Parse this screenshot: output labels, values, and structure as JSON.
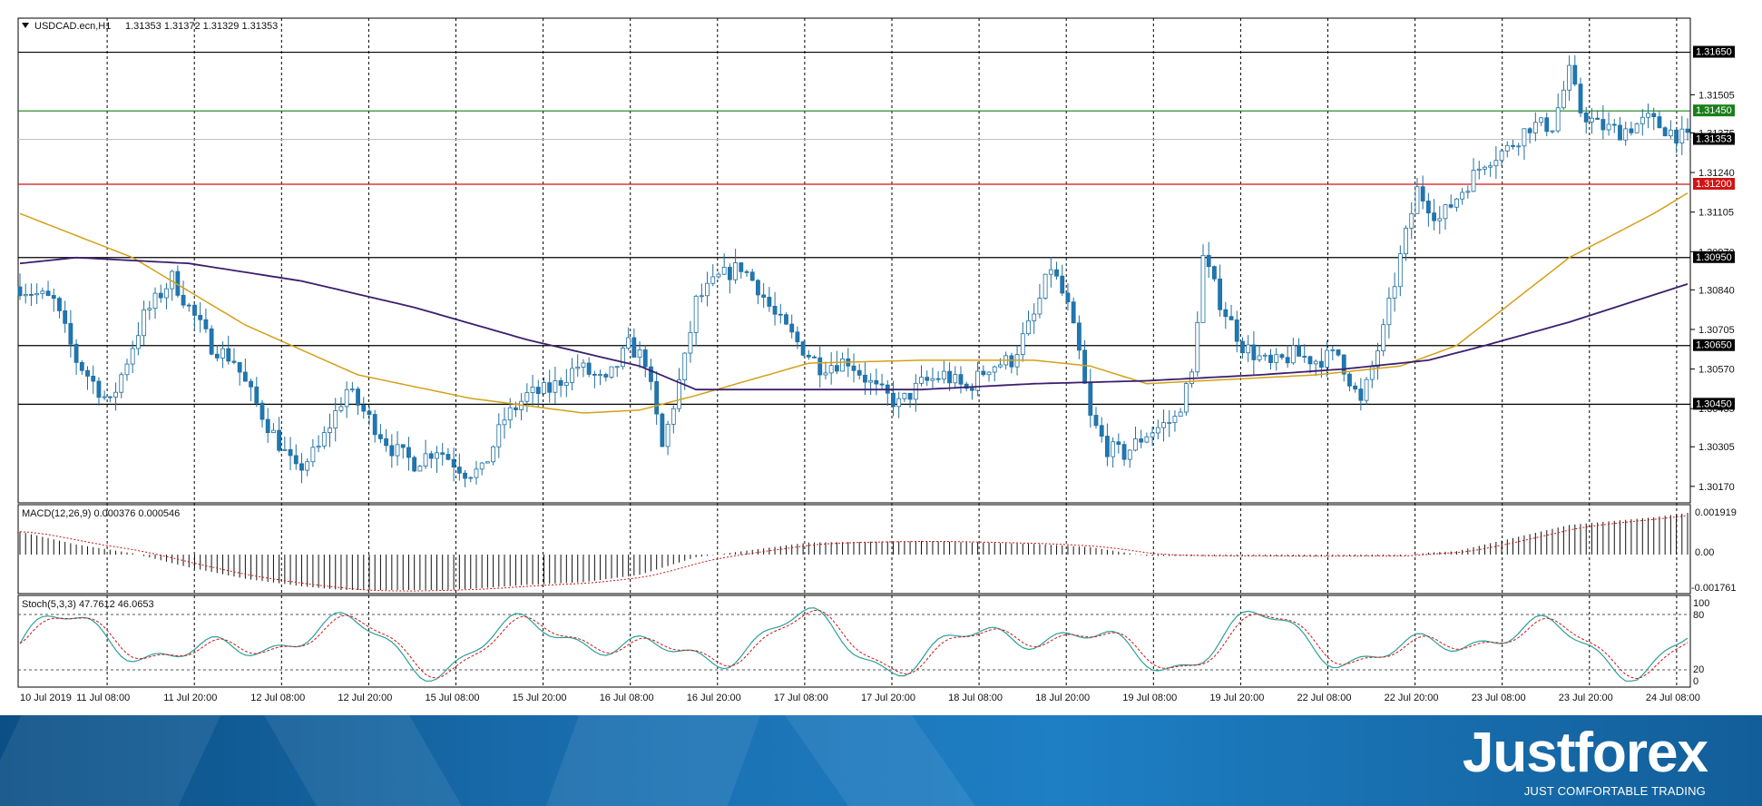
{
  "header": {
    "symbol": "USDCAD.ecn,H1",
    "ohlc": "1.31353 1.31372 1.31329 1.31353"
  },
  "colors": {
    "candle_up": "#ffffff",
    "candle_down": "#1f77b4",
    "candle_outline": "#1f6e9e",
    "ma_fast": "#d4a017",
    "ma_slow": "#3c1f6e",
    "level_black": "#000000",
    "level_green": "#1a7f1a",
    "level_red": "#d11414",
    "bid_line": "#bfbfbf",
    "macd_signal": "#d11414",
    "stoch_main": "#2aa198",
    "stoch_signal": "#d11414",
    "footer_blue": "#1a6fb0"
  },
  "price_axis": {
    "labels": [
      "1.31505",
      "1.31375",
      "1.31240",
      "1.31105",
      "1.30970",
      "1.30840",
      "1.30705",
      "1.30570",
      "1.30435",
      "1.30305",
      "1.30170"
    ]
  },
  "levels": [
    {
      "label": "1.31650",
      "value": 1.3165,
      "color": "black"
    },
    {
      "label": "1.31450",
      "value": 1.3145,
      "color": "green"
    },
    {
      "label": "1.31200",
      "value": 1.312,
      "color": "red"
    },
    {
      "label": "1.30950",
      "value": 1.3095,
      "color": "black"
    },
    {
      "label": "1.30650",
      "value": 1.3065,
      "color": "black"
    },
    {
      "label": "1.30450",
      "value": 1.3045,
      "color": "black"
    }
  ],
  "bid": {
    "label": "1.31353",
    "value": 1.31353
  },
  "time_axis": {
    "labels": [
      "10 Jul 2019",
      "11 Jul 08:00",
      "11 Jul 20:00",
      "12 Jul 08:00",
      "12 Jul 20:00",
      "15 Jul 08:00",
      "15 Jul 20:00",
      "16 Jul 08:00",
      "16 Jul 20:00",
      "17 Jul 08:00",
      "17 Jul 20:00",
      "18 Jul 08:00",
      "18 Jul 20:00",
      "19 Jul 08:00",
      "19 Jul 20:00",
      "22 Jul 08:00",
      "22 Jul 20:00",
      "23 Jul 08:00",
      "23 Jul 20:00",
      "24 Jul 08:00"
    ]
  },
  "macd": {
    "title": "MACD(12,26,9) 0.000376 0.000546",
    "axis_labels": [
      "0.001919",
      "0.00",
      "-0.001761"
    ]
  },
  "stoch": {
    "title": "Stoch(5,3,3) 47.7612 46.0653",
    "axis_labels": [
      "100",
      "80",
      "20",
      "0"
    ]
  },
  "footer": {
    "brand": "Justforex",
    "tagline": "JUST COMFORTABLE TRADING"
  },
  "chart_data": {
    "type": "candlestick",
    "symbol": "USDCAD",
    "timeframe": "H1",
    "ylim": [
      1.3012,
      1.3176
    ],
    "close_path": [
      [
        0,
        1.3085
      ],
      [
        6,
        1.308
      ],
      [
        10,
        1.306
      ],
      [
        16,
        1.3045
      ],
      [
        22,
        1.3075
      ],
      [
        27,
        1.3088
      ],
      [
        30,
        1.3078
      ],
      [
        34,
        1.3065
      ],
      [
        38,
        1.306
      ],
      [
        40,
        1.3052
      ],
      [
        44,
        1.3038
      ],
      [
        49,
        1.3022
      ],
      [
        53,
        1.303
      ],
      [
        58,
        1.305
      ],
      [
        62,
        1.304
      ],
      [
        66,
        1.303
      ],
      [
        70,
        1.3025
      ],
      [
        74,
        1.303
      ],
      [
        79,
        1.3022
      ],
      [
        82,
        1.3022
      ],
      [
        86,
        1.304
      ],
      [
        90,
        1.3048
      ],
      [
        94,
        1.305
      ],
      [
        99,
        1.3058
      ],
      [
        104,
        1.3052
      ],
      [
        108,
        1.3065
      ],
      [
        111,
        1.306
      ],
      [
        114,
        1.303
      ],
      [
        118,
        1.306
      ],
      [
        120,
        1.308
      ],
      [
        124,
        1.3088
      ],
      [
        128,
        1.3092
      ],
      [
        131,
        1.3085
      ],
      [
        134,
        1.3075
      ],
      [
        138,
        1.3066
      ],
      [
        142,
        1.3058
      ],
      [
        147,
        1.306
      ],
      [
        152,
        1.305
      ],
      [
        156,
        1.3045
      ],
      [
        160,
        1.3052
      ],
      [
        164,
        1.3055
      ],
      [
        168,
        1.305
      ],
      [
        172,
        1.3058
      ],
      [
        176,
        1.306
      ],
      [
        180,
        1.3075
      ],
      [
        183,
        1.3092
      ],
      [
        186,
        1.3078
      ],
      [
        188,
        1.3062
      ],
      [
        190,
        1.304
      ],
      [
        193,
        1.303
      ],
      [
        196,
        1.3028
      ],
      [
        200,
        1.3035
      ],
      [
        205,
        1.304
      ],
      [
        208,
        1.3055
      ],
      [
        210,
        1.3095
      ],
      [
        213,
        1.308
      ],
      [
        217,
        1.3065
      ],
      [
        222,
        1.3058
      ],
      [
        226,
        1.3062
      ],
      [
        230,
        1.306
      ],
      [
        234,
        1.3062
      ],
      [
        238,
        1.3045
      ],
      [
        242,
        1.307
      ],
      [
        245,
        1.3095
      ],
      [
        248,
        1.3118
      ],
      [
        252,
        1.3108
      ],
      [
        256,
        1.3118
      ],
      [
        260,
        1.3128
      ],
      [
        264,
        1.3132
      ],
      [
        268,
        1.314
      ],
      [
        272,
        1.314
      ],
      [
        275,
        1.3158
      ],
      [
        277,
        1.3145
      ],
      [
        280,
        1.314
      ],
      [
        284,
        1.3138
      ],
      [
        289,
        1.3142
      ],
      [
        293,
        1.3138
      ],
      [
        296,
        1.3135
      ]
    ],
    "ma_fast_path": [
      [
        0,
        1.311
      ],
      [
        20,
        1.3095
      ],
      [
        40,
        1.3072
      ],
      [
        60,
        1.3055
      ],
      [
        80,
        1.3047
      ],
      [
        100,
        1.3042
      ],
      [
        110,
        1.3043
      ],
      [
        120,
        1.3048
      ],
      [
        140,
        1.3059
      ],
      [
        160,
        1.306
      ],
      [
        180,
        1.306
      ],
      [
        190,
        1.3058
      ],
      [
        200,
        1.3052
      ],
      [
        210,
        1.3053
      ],
      [
        230,
        1.3055
      ],
      [
        245,
        1.3058
      ],
      [
        255,
        1.3065
      ],
      [
        265,
        1.308
      ],
      [
        275,
        1.3095
      ],
      [
        290,
        1.311
      ],
      [
        296,
        1.3117
      ]
    ],
    "ma_slow_path": [
      [
        0,
        1.3093
      ],
      [
        10,
        1.3095
      ],
      [
        30,
        1.3093
      ],
      [
        50,
        1.3087
      ],
      [
        70,
        1.3078
      ],
      [
        90,
        1.3067
      ],
      [
        110,
        1.3058
      ],
      [
        120,
        1.305
      ],
      [
        140,
        1.305
      ],
      [
        160,
        1.305
      ],
      [
        180,
        1.3052
      ],
      [
        200,
        1.3053
      ],
      [
        220,
        1.3055
      ],
      [
        235,
        1.3057
      ],
      [
        250,
        1.306
      ],
      [
        260,
        1.3065
      ],
      [
        275,
        1.3073
      ],
      [
        296,
        1.3086
      ]
    ],
    "n_bars": 297
  }
}
